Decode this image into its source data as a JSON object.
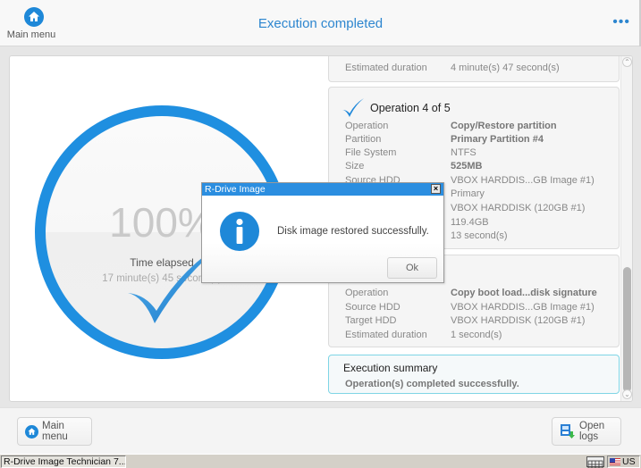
{
  "header": {
    "menu_label": "Main menu",
    "title": "Execution completed",
    "more_icon": "..."
  },
  "progress": {
    "percent_text": "100%",
    "percent_value": 100,
    "elapsed_label": "Time elapsed",
    "elapsed_value": "17 minute(s) 45 second(s)"
  },
  "operations": {
    "prev_card": {
      "rows": [
        {
          "key": "Estimated duration",
          "value": "4 minute(s) 47 second(s)",
          "bold": false
        }
      ]
    },
    "op4": {
      "title": "Operation 4 of 5",
      "rows": [
        {
          "key": "Operation",
          "value": "Copy/Restore partition",
          "bold": true
        },
        {
          "key": "Partition",
          "value": "Primary Partition #4",
          "bold": true
        },
        {
          "key": "File System",
          "value": "NTFS",
          "bold": false
        },
        {
          "key": "Size",
          "value": "525MB",
          "bold": true
        },
        {
          "key": "Source HDD",
          "value": "VBOX HARDDIS...GB Image #1)",
          "bold": false
        },
        {
          "key": "",
          "value": "Primary",
          "bold": false
        },
        {
          "key": "",
          "value": "VBOX HARDDISK (120GB #1)",
          "bold": false
        },
        {
          "key": "",
          "value": "119.4GB",
          "bold": false
        },
        {
          "key": "",
          "value": "13 second(s)",
          "bold": false
        }
      ]
    },
    "op5": {
      "rows": [
        {
          "key": "Operation",
          "value": "Copy boot load...disk signature",
          "bold": true
        },
        {
          "key": "Source HDD",
          "value": "VBOX HARDDIS...GB Image #1)",
          "bold": false
        },
        {
          "key": "Target HDD",
          "value": "VBOX HARDDISK (120GB #1)",
          "bold": false
        },
        {
          "key": "Estimated duration",
          "value": "1 second(s)",
          "bold": false
        }
      ]
    },
    "summary": {
      "title": "Execution summary",
      "text": "Operation(s) completed successfully."
    }
  },
  "dialog": {
    "title": "R-Drive Image",
    "close": "×",
    "message": "Disk image restored successfully.",
    "ok_label": "Ok"
  },
  "footer": {
    "main_menu_label": "Main menu",
    "open_logs_label": "Open logs"
  },
  "taskbar": {
    "task_label": "R-Drive Image Technician 7....",
    "lang": "US"
  },
  "colors": {
    "accent": "#1f8fe0",
    "title": "#2d86cf",
    "summary_border": "#7fd5e5"
  }
}
